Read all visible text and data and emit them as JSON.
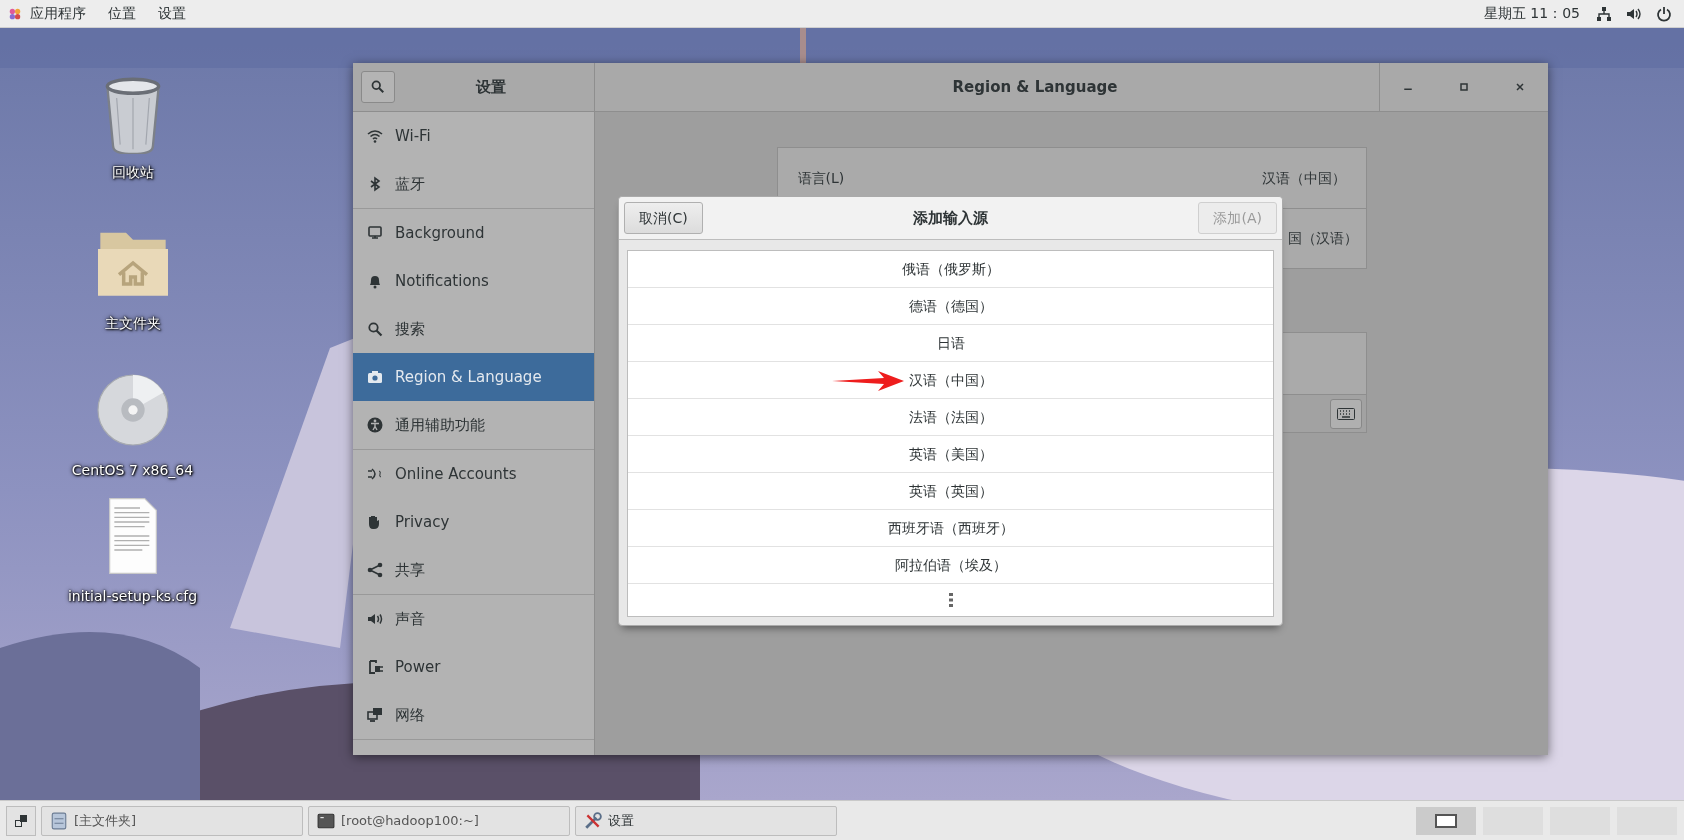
{
  "top_bar": {
    "menus": [
      "应用程序",
      "位置",
      "设置"
    ],
    "clock": "星期五 11：05"
  },
  "desktop_icons": [
    {
      "label": "回收站",
      "kind": "trash"
    },
    {
      "label": "主文件夹",
      "kind": "folder"
    },
    {
      "label": "CentOS 7 x86_64",
      "kind": "disc"
    },
    {
      "label": "initial-setup-ks.cfg",
      "kind": "document"
    }
  ],
  "settings_window": {
    "sidebar_title": "设置",
    "title": "Region & Language",
    "sidebar": [
      {
        "items": [
          {
            "label": "Wi-Fi",
            "selected": false
          },
          {
            "label": "蓝牙",
            "selected": false
          }
        ]
      },
      {
        "items": [
          {
            "label": "Background",
            "selected": false
          },
          {
            "label": "Notifications",
            "selected": false
          },
          {
            "label": "搜索",
            "selected": false
          },
          {
            "label": "Region & Language",
            "selected": true
          },
          {
            "label": "通用辅助功能",
            "selected": false
          }
        ]
      },
      {
        "items": [
          {
            "label": "Online Accounts",
            "selected": false
          },
          {
            "label": "Privacy",
            "selected": false
          },
          {
            "label": "共享",
            "selected": false
          }
        ]
      },
      {
        "items": [
          {
            "label": "声音",
            "selected": false
          },
          {
            "label": "Power",
            "selected": false
          },
          {
            "label": "网络",
            "selected": false
          }
        ]
      }
    ],
    "language_row": {
      "label": "语言(L)",
      "value": "汉语（中国）"
    },
    "formats_row": {
      "value": "国（汉语）"
    }
  },
  "dialog": {
    "title": "添加输入源",
    "cancel_button": "取消(C)",
    "add_button": {
      "label": "添加(A)",
      "disabled": true
    },
    "languages": [
      "俄语（俄罗斯）",
      "德语（德国）",
      "日语",
      "汉语（中国）",
      "法语（法国）",
      "英语（美国）",
      "英语（英国）",
      "西班牙语（西班牙）",
      "阿拉伯语（埃及）"
    ]
  },
  "taskbar": {
    "tasks": [
      {
        "label": "[主文件夹]",
        "kind": "files"
      },
      {
        "label": "[root@hadoop100:~]",
        "kind": "terminal"
      },
      {
        "label": "设置",
        "kind": "tools"
      }
    ],
    "workspaces": [
      {
        "selected": true
      },
      {
        "selected": false
      },
      {
        "selected": false
      },
      {
        "selected": false
      }
    ]
  }
}
